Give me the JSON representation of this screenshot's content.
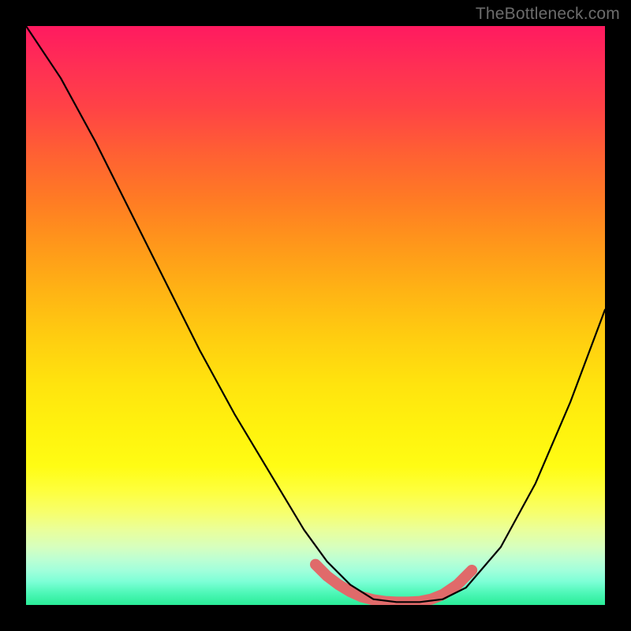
{
  "watermark": "TheBottleneck.com",
  "chart_data": {
    "type": "line",
    "title": "",
    "xlabel": "",
    "ylabel": "",
    "xlim": [
      0,
      1
    ],
    "ylim": [
      0,
      1
    ],
    "series": [
      {
        "name": "curve",
        "stroke": "#000000",
        "stroke_width": 2.2,
        "x": [
          0.0,
          0.06,
          0.12,
          0.18,
          0.24,
          0.3,
          0.36,
          0.42,
          0.48,
          0.52,
          0.56,
          0.6,
          0.64,
          0.68,
          0.72,
          0.76,
          0.82,
          0.88,
          0.94,
          1.0
        ],
        "values": [
          1.0,
          0.91,
          0.8,
          0.68,
          0.56,
          0.44,
          0.33,
          0.23,
          0.13,
          0.075,
          0.035,
          0.01,
          0.005,
          0.005,
          0.01,
          0.03,
          0.1,
          0.21,
          0.35,
          0.51
        ]
      },
      {
        "name": "highlight-band",
        "stroke": "#e06a6a",
        "stroke_width": 14,
        "x": [
          0.5,
          0.52,
          0.54,
          0.56,
          0.58,
          0.6,
          0.62,
          0.64,
          0.66,
          0.68,
          0.7,
          0.72,
          0.745,
          0.77
        ],
        "values": [
          0.07,
          0.05,
          0.035,
          0.023,
          0.014,
          0.009,
          0.006,
          0.005,
          0.005,
          0.006,
          0.01,
          0.018,
          0.035,
          0.06
        ]
      }
    ],
    "background_gradient": {
      "type": "vertical",
      "stops": [
        {
          "pos": 0.0,
          "color": "#ff1a60"
        },
        {
          "pos": 0.5,
          "color": "#ffd010"
        },
        {
          "pos": 0.8,
          "color": "#fdff40"
        },
        {
          "pos": 1.0,
          "color": "#2aec98"
        }
      ]
    }
  }
}
